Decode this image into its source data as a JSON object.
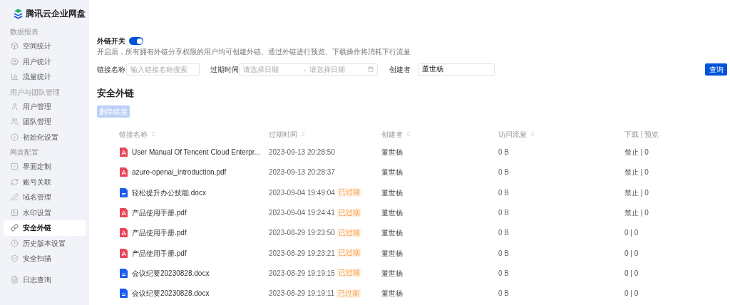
{
  "sidebar": {
    "brand": "腾讯云企业网盘",
    "sections": [
      {
        "label": "数据报表",
        "items": [
          {
            "label": "空间统计",
            "selected": false
          },
          {
            "label": "用户统计",
            "selected": false
          },
          {
            "label": "流量统计",
            "selected": false
          }
        ]
      },
      {
        "label": "用户与团队管理",
        "items": [
          {
            "label": "用户管理",
            "selected": false
          },
          {
            "label": "团队管理",
            "selected": false
          },
          {
            "label": "初始化设置",
            "selected": false
          }
        ]
      },
      {
        "label": "网盘配置",
        "items": [
          {
            "label": "界面定制",
            "selected": false
          },
          {
            "label": "账号关联",
            "selected": false
          },
          {
            "label": "域名管理",
            "selected": false
          },
          {
            "label": "水印设置",
            "selected": false
          },
          {
            "label": "安全外链",
            "selected": true
          },
          {
            "label": "历史版本设置",
            "selected": false
          },
          {
            "label": "安全扫描",
            "selected": false
          }
        ]
      },
      {
        "items": [
          {
            "label": "日志查询",
            "selected": false
          }
        ]
      }
    ]
  },
  "switch": {
    "label": "外链开关",
    "on": true,
    "description": "开启后，所有拥有外链分享权限的用户均可创建外链。通过外链进行预览、下载操作将消耗下行流量"
  },
  "filters": {
    "name": {
      "label": "链接名称",
      "placeholder": "输入链接名称搜索"
    },
    "expiry": {
      "label": "过期时间",
      "start_placeholder": "请选择日期",
      "separator": "-",
      "end_placeholder": "请选择日期"
    },
    "creator": {
      "label": "创建者",
      "value": "董世杨"
    },
    "search_button": "查询"
  },
  "section_title": "安全外链",
  "delete_button": {
    "label": "删除链接",
    "disabled": true
  },
  "table": {
    "columns": [
      "链接名称",
      "过期时间",
      "创建者",
      "访问流量",
      "下载 | 预览"
    ],
    "rows": [
      {
        "kind": "pdf",
        "name": "User Manual Of Tencent Cloud Enterpr...",
        "expiry": "2023-09-13 20:28:50",
        "creator": "董世杨",
        "traffic": "0 B",
        "access": "禁止 | 0"
      },
      {
        "kind": "pdf",
        "name": "azure-openai_introduction.pdf",
        "expiry": "2023-09-13 20:28:37",
        "creator": "董世杨",
        "traffic": "0 B",
        "access": "禁止 | 0"
      },
      {
        "kind": "doc",
        "name": "轻松提升办公技能.docx",
        "expiry": "2023-09-04 19:49:04",
        "badge": "已过期",
        "creator": "董世杨",
        "traffic": "0 B",
        "access": "禁止 | 0"
      },
      {
        "kind": "pdf",
        "name": "产品使用手册.pdf",
        "expiry": "2023-09-04 19:24:41",
        "badge": "已过期",
        "creator": "董世杨",
        "traffic": "0 B",
        "access": "禁止 | 0"
      },
      {
        "kind": "pdf",
        "name": "产品使用手册.pdf",
        "expiry": "2023-08-29 19:23:50",
        "badge": "已过期",
        "creator": "董世杨",
        "traffic": "0 B",
        "access": "0 | 0"
      },
      {
        "kind": "pdf",
        "name": "产品使用手册.pdf",
        "expiry": "2023-08-29 19:23:21",
        "badge": "已过期",
        "creator": "董世杨",
        "traffic": "0 B",
        "access": "0 | 0"
      },
      {
        "kind": "doc",
        "name": "会议纪要20230828.docx",
        "expiry": "2023-08-29 19:19:15",
        "badge": "已过期",
        "creator": "董世杨",
        "traffic": "0 B",
        "access": "0 | 0"
      },
      {
        "kind": "doc",
        "name": "会议纪要20230828.docx",
        "expiry": "2023-08-29 19:19:11",
        "badge": "已过期",
        "creator": "董世杨",
        "traffic": "0 B",
        "access": "0 | 0"
      }
    ]
  }
}
